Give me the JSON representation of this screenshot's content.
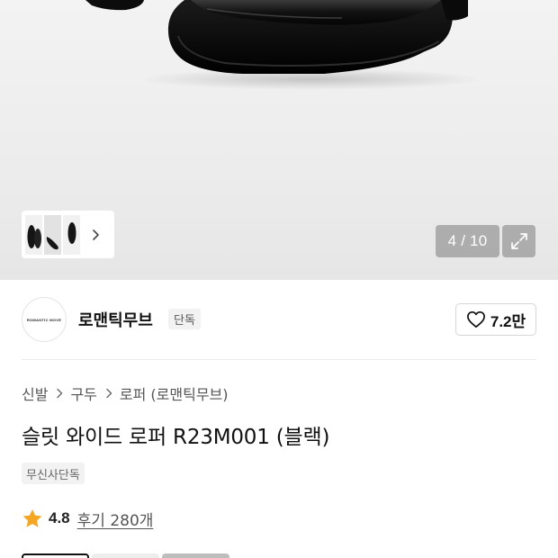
{
  "gallery": {
    "counter": "4 / 10",
    "thumbnails": [
      {
        "icon": "loafer-pair-front-thumbnail",
        "active": false
      },
      {
        "icon": "loafer-side-thumbnail",
        "active": true
      },
      {
        "icon": "loafer-pair-thumbnail",
        "active": false
      }
    ],
    "next_icon": "chevron-right-icon",
    "expand_icon": "expand-icon"
  },
  "brand": {
    "logo_text": "ROMANTIC MOVE",
    "name": "로맨틱무브",
    "tag": "단독",
    "like_count": "7.2만",
    "like_icon": "heart-outline-icon"
  },
  "breadcrumb": [
    "신발",
    "구두",
    "로퍼 (로맨틱무브)"
  ],
  "title": "슬릿 와이드 로퍼 R23M001 (블랙)",
  "exclusive_badge": "무신사단독",
  "rating": {
    "score": "4.8",
    "reviews": "후기 280개",
    "star_color": "#f5a623"
  },
  "colors": {
    "accent": "#111111",
    "badge_bg": "#f2f2f2",
    "overlay_bg": "#969696"
  }
}
